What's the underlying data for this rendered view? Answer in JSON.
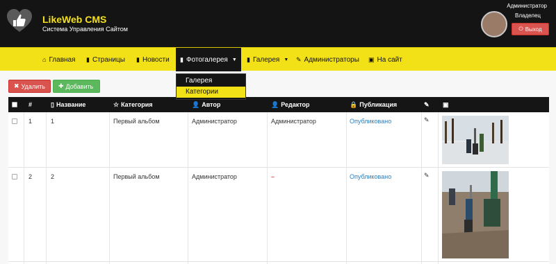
{
  "header": {
    "brand_title": "LikeWeb CMS",
    "brand_subtitle": "Система Управления Сайтом",
    "user_name": "Администратор",
    "user_role": "Владелец",
    "logout_label": "Выход"
  },
  "nav": {
    "items": [
      {
        "label": "Главная",
        "icon": "home-icon"
      },
      {
        "label": "Страницы",
        "icon": "bookmark-icon"
      },
      {
        "label": "Новости",
        "icon": "book-icon"
      },
      {
        "label": "Фотогалерея",
        "icon": "bookmark-icon"
      },
      {
        "label": "Галерея",
        "icon": "bookmark-icon"
      },
      {
        "label": "Администраторы",
        "icon": "wrench-icon"
      },
      {
        "label": "На сайт",
        "icon": "image-icon"
      }
    ],
    "dropdown": [
      "Галерея",
      "Категории"
    ]
  },
  "toolbar": {
    "delete_label": "Удалить",
    "add_label": "Добавить"
  },
  "table": {
    "columns": [
      "#",
      "Название",
      "Категория",
      "Автор",
      "Редактор",
      "Публикация"
    ],
    "rows": [
      {
        "num": "1",
        "title": "1",
        "category": "Первый альбом",
        "author": "Администратор",
        "editor": "Администратор",
        "status": "Опубликовано"
      },
      {
        "num": "2",
        "title": "2",
        "category": "Первый альбом",
        "author": "Администратор",
        "editor": "–",
        "status": "Опубликовано"
      }
    ]
  },
  "colors": {
    "accent_yellow": "#f2e116",
    "header_black": "#141414",
    "danger": "#d9534f",
    "success": "#5cb85c",
    "link": "#2a7dc0"
  }
}
